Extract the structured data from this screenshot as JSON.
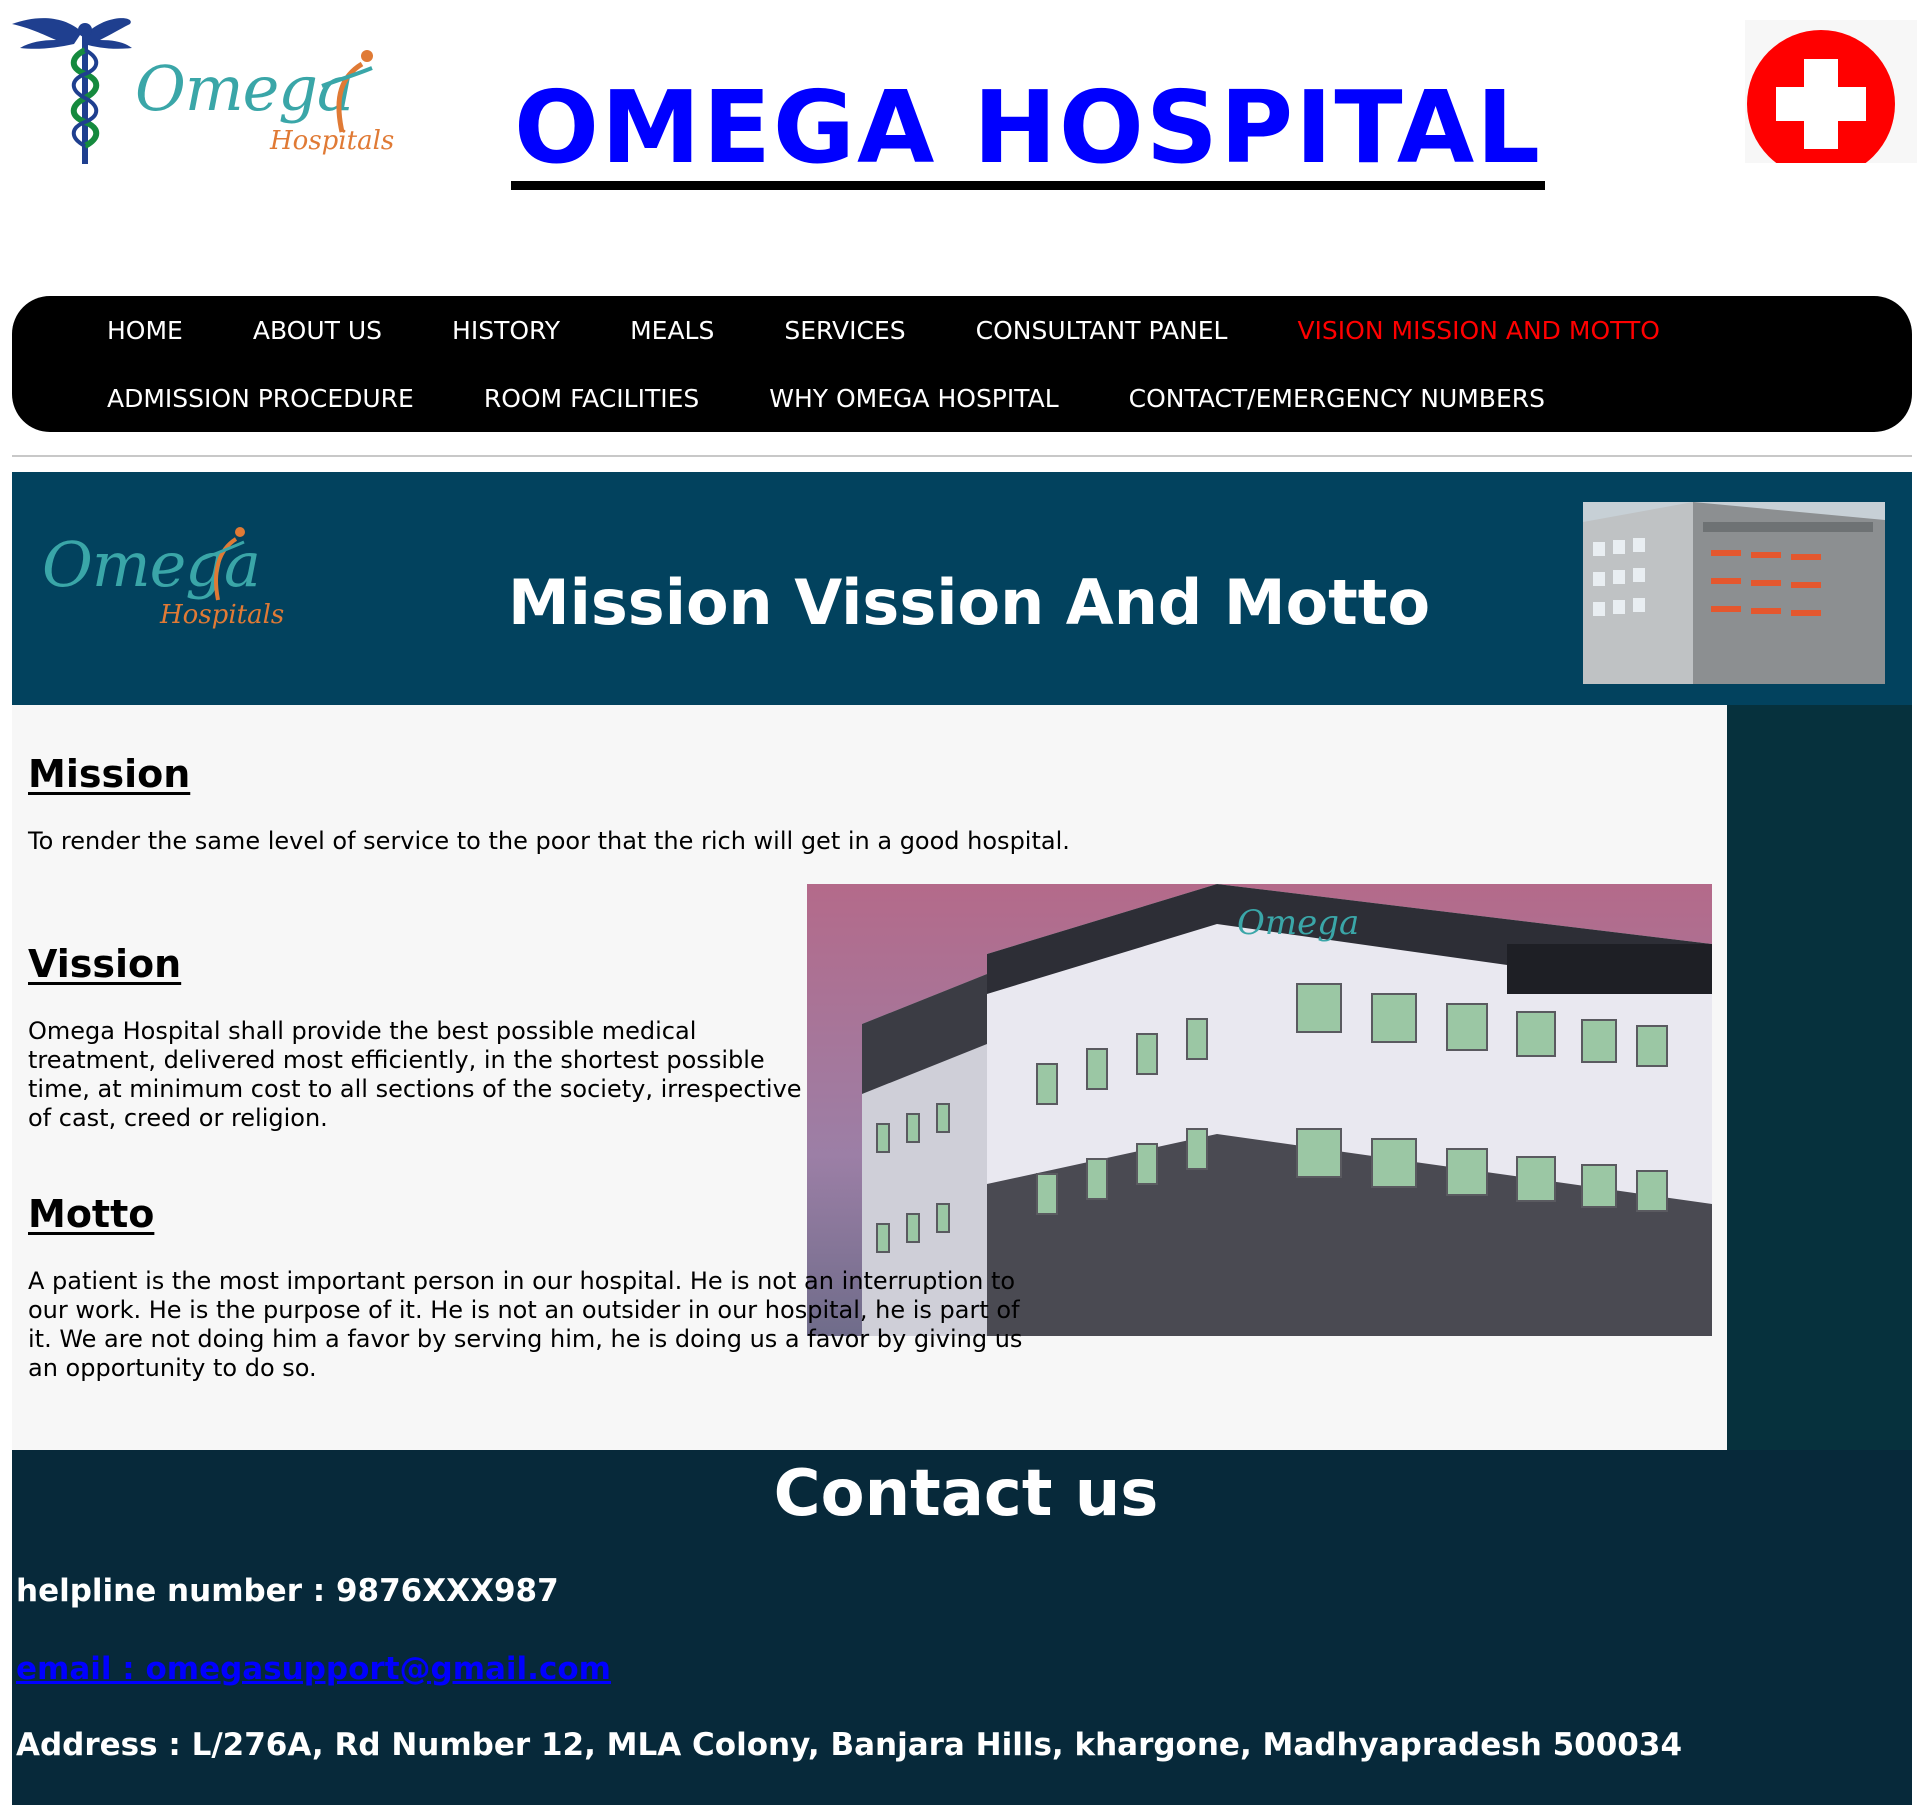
{
  "header": {
    "logo_text": "Omega",
    "logo_subtext": "Hospitals",
    "title": "OMEGA HOSPITAL"
  },
  "nav": {
    "row1": [
      {
        "label": "HOME",
        "active": false
      },
      {
        "label": "ABOUT US",
        "active": false
      },
      {
        "label": "HISTORY",
        "active": false
      },
      {
        "label": "MEALS",
        "active": false
      },
      {
        "label": "SERVICES",
        "active": false
      },
      {
        "label": "CONSULTANT PANEL",
        "active": false
      },
      {
        "label": "VISION MISSION AND MOTTO",
        "active": true
      }
    ],
    "row2": [
      {
        "label": "ADMISSION PROCEDURE",
        "active": false
      },
      {
        "label": "ROOM FACILITIES",
        "active": false
      },
      {
        "label": "WHY OMEGA HOSPITAL",
        "active": false
      },
      {
        "label": "CONTACT/EMERGENCY NUMBERS",
        "active": false
      }
    ]
  },
  "banner": {
    "title": "Mission Vission And Motto",
    "logo_text": "Omega",
    "logo_subtext": "Hospitals"
  },
  "content": {
    "mission": {
      "heading": "Mission",
      "text": "To render the same level of service to the poor that the rich will get in a good hospital."
    },
    "vission": {
      "heading": "Vission",
      "text": "Omega Hospital shall provide the best possible medical treatment, delivered most efficiently, in the shortest possible time, at minimum cost to all sections of the society, irrespective of cast, creed or religion."
    },
    "motto": {
      "heading": "Motto",
      "text": "A patient is the most important person in our hospital. He is not an interruption to our work. He is the purpose of it. He is not an outsider in our hospital, he is part of it. We are not doing him a favor by serving him, he is doing us a favor by giving us an opportunity to do so."
    },
    "building_sign": "Omega"
  },
  "footer": {
    "heading": "Contact us",
    "helpline": "helpline number : 9876XXX987",
    "email": "email : omegasupport@gmail.com",
    "address": "Address : L/276A, Rd Number 12, MLA Colony, Banjara Hills, khargone, Madhyapradesh 500034"
  },
  "colors": {
    "title_link": "#0000ff",
    "nav_bg": "#000000",
    "nav_active": "#ff0000",
    "banner_bg": "#02425e",
    "content_bg": "#f7f7f7",
    "footer_bg": "#07293a",
    "logo_teal": "#3aa6a8",
    "logo_orange": "#e07a35",
    "cross_red": "#ff0000"
  }
}
